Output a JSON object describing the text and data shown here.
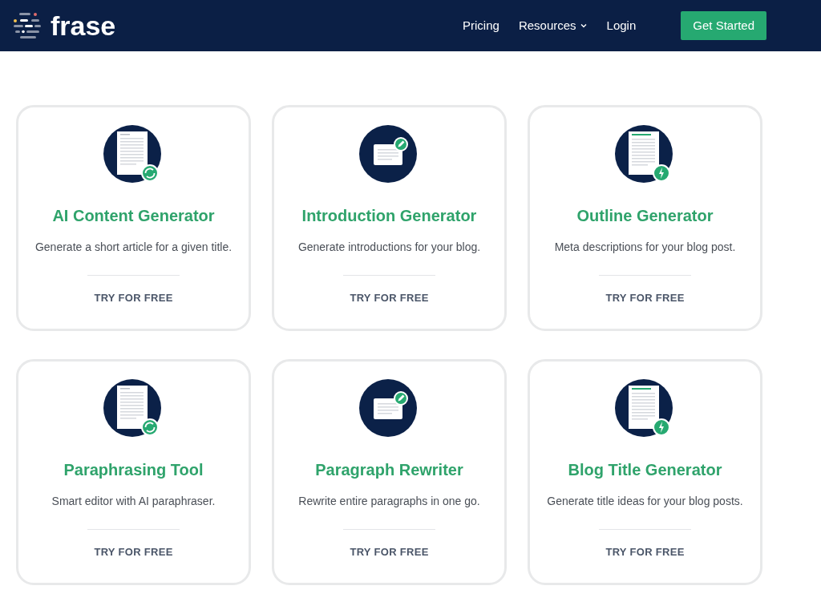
{
  "nav": {
    "logo": "frase",
    "links": [
      {
        "label": "Pricing",
        "dropdown": false
      },
      {
        "label": "Resources",
        "dropdown": true
      },
      {
        "label": "Login",
        "dropdown": false
      }
    ],
    "cta": "Get Started"
  },
  "cards": [
    {
      "kind": "document-refresh",
      "title": "AI Content Generator",
      "description": "Generate a short article for a given title.",
      "action": "TRY FOR FREE"
    },
    {
      "kind": "card-edit",
      "title": "Introduction Generator",
      "description": "Generate introductions for your blog.",
      "action": "TRY FOR FREE"
    },
    {
      "kind": "document-bolt",
      "title": "Outline Generator",
      "description": "Meta descriptions for your blog post.",
      "action": "TRY FOR FREE"
    },
    {
      "kind": "document-refresh",
      "title": "Paraphrasing Tool",
      "description": "Smart editor with AI paraphraser.",
      "action": "TRY FOR FREE"
    },
    {
      "kind": "card-edit",
      "title": "Paragraph Rewriter",
      "description": "Rewrite entire paragraphs in one go.",
      "action": "TRY FOR FREE"
    },
    {
      "kind": "document-bolt",
      "title": "Blog Title Generator",
      "description": "Generate title ideas for your blog posts.",
      "action": "TRY FOR FREE"
    }
  ]
}
